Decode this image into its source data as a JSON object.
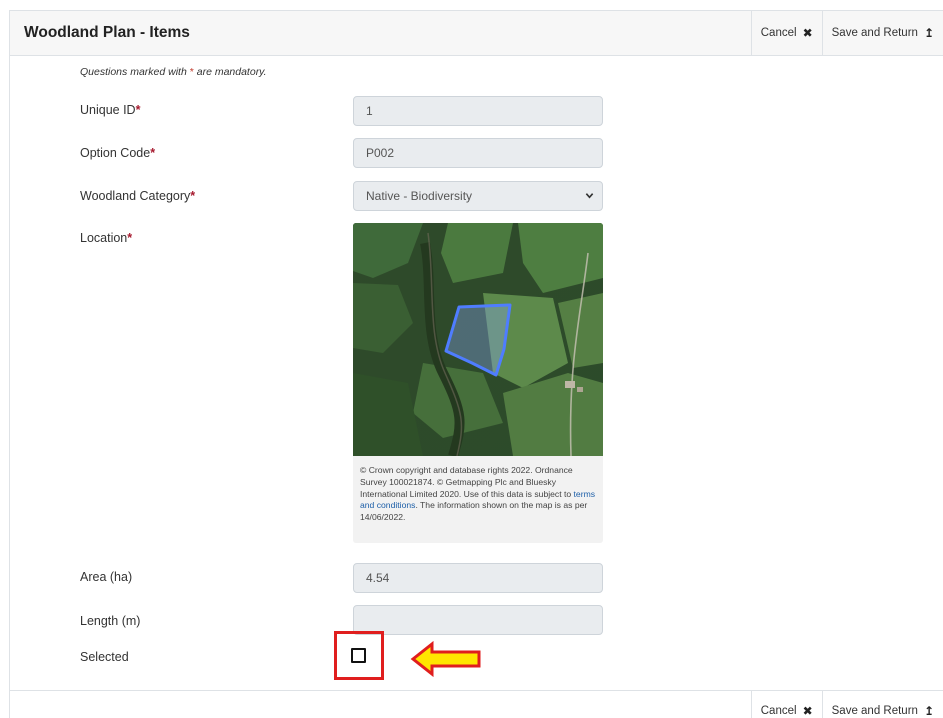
{
  "header": {
    "title": "Woodland Plan - Items",
    "cancel_label": "Cancel",
    "save_return_label": "Save and Return"
  },
  "form": {
    "mandatory_note_prefix": "Questions marked with",
    "mandatory_star": "*",
    "mandatory_note_suffix": "are mandatory.",
    "required_marker": "*",
    "unique_id": {
      "label": "Unique ID",
      "value": "1"
    },
    "option_code": {
      "label": "Option Code",
      "value": "P002"
    },
    "woodland_category": {
      "label": "Woodland Category",
      "value": "Native - Biodiversity"
    },
    "location": {
      "label": "Location",
      "caption_pre": "© Crown copyright and database rights 2022. Ordnance Survey 100021874. © Getmapping Plc and Bluesky International Limited 2020. Use of this data is subject to",
      "caption_link": "terms and conditions",
      "caption_post": ". The information shown on the map is as per 14/06/2022."
    },
    "area": {
      "label": "Area (ha)",
      "value": "4.54"
    },
    "length": {
      "label": "Length (m)",
      "value": ""
    },
    "selected": {
      "label": "Selected",
      "checked": false
    }
  },
  "footer": {
    "cancel_label": "Cancel",
    "save_return_label": "Save and Return"
  },
  "icons": {
    "cancel": "close-icon",
    "save": "return-icon",
    "select": "chevron-down-icon",
    "callout": "arrow-left-icon"
  },
  "colors": {
    "required": "#a6192e",
    "highlight": "#e01e1e",
    "arrow_fill": "#ffe600",
    "link": "#1d5fa8",
    "polygon": "#4f7dff"
  }
}
